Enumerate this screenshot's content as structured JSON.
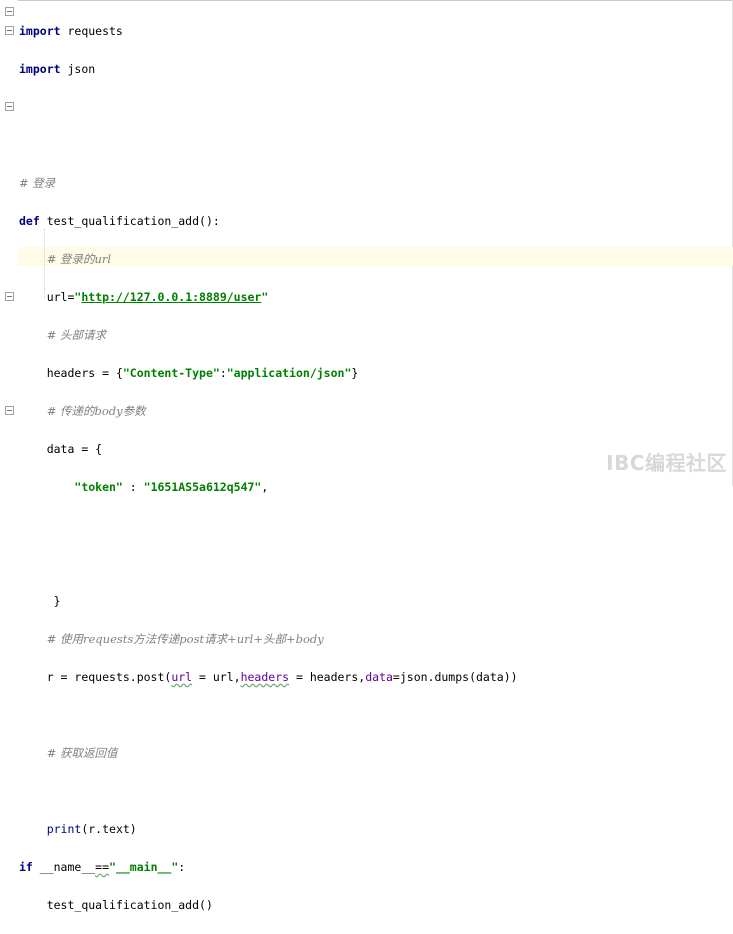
{
  "editor": {
    "lines": {
      "l1_kw": "import",
      "l1_rest": " requests",
      "l2_kw": "import",
      "l2_rest": " json",
      "l5_cm": "# 登录",
      "l6_kw": "def",
      "l6_rest": " test_qualification_add():",
      "l7_cm": "# 登录的url",
      "l8_a": "url=",
      "l8_q1": "\"",
      "l8_url": "http://127.0.0.1:8889/user",
      "l8_q2": "\"",
      "l9_cm": "# 头部请求",
      "l10_a": "headers = {",
      "l10_s1": "\"Content-Type\"",
      "l10_colon": ":",
      "l10_s2": "\"application/json\"",
      "l10_end": "}",
      "l11_cm": "# 传递的body参数",
      "l12_a": "data = {",
      "l13_s1": "\"token\"",
      "l13_colon": " : ",
      "l13_s2": "\"1651AS5a612q547\"",
      "l13_end": ",",
      "l16_a": "}",
      "l17_cm": "# 使用requests方法传递post请求+url+头部+body",
      "l18_a": "r = requests.post(",
      "l18_k1": "url",
      "l18_b": " = url,",
      "l18_k2": "headers",
      "l18_c": " = headers,",
      "l18_k3": "data",
      "l18_d": "=json.dumps(data))",
      "l20_cm": "# 获取返回值",
      "l22_fn": "print",
      "l22_rest": "(r.text)",
      "l23_kw": "if",
      "l23_a": " __name__",
      "l23_b": "==",
      "l23_s": "\"__main__\"",
      "l23_c": ":",
      "l24_a": "test_qualification_add()"
    }
  },
  "watermark": "IBC编程社区"
}
